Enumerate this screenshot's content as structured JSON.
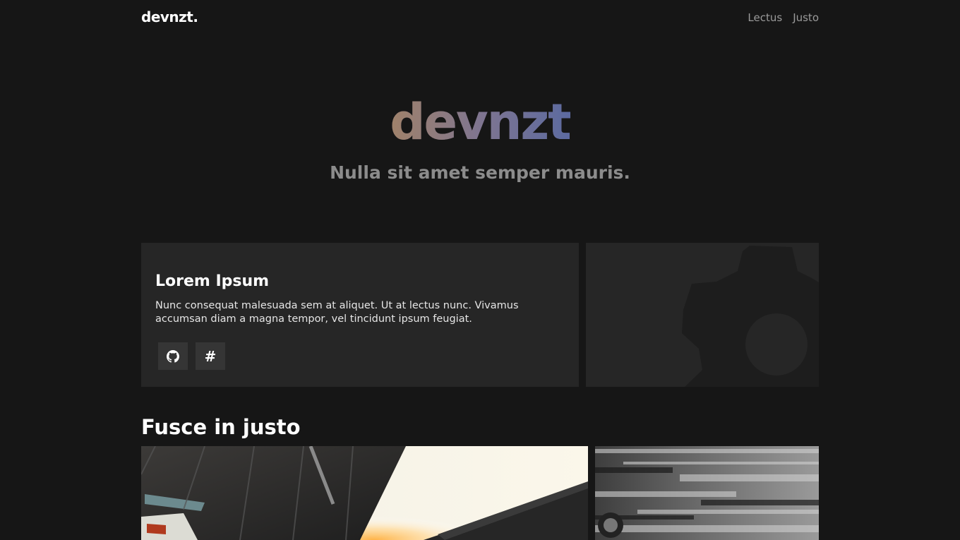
{
  "header": {
    "brand": "devnzt.",
    "nav": [
      {
        "label": "Lectus"
      },
      {
        "label": "Justo"
      }
    ]
  },
  "hero": {
    "title": "devnzt",
    "subtitle": "Nulla sit amet semper mauris."
  },
  "project": {
    "title": "Lorem Ipsum",
    "description": "Nunc consequat malesuada sem at aliquet. Ut at lectus nunc. Vivamus accumsan diam a magna tempor, vel tincidunt ipsum feugiat.",
    "buttons": [
      {
        "icon": "github-icon"
      },
      {
        "icon": "hash-icon",
        "glyph": "#"
      }
    ],
    "image_icon": "gear-icon"
  },
  "section": {
    "title": "Fusce in justo"
  },
  "colors": {
    "background": "#161616",
    "card": "#262626",
    "gradient_start": "#a0826a",
    "gradient_end": "#5c6aa0",
    "muted_text": "#8c8c8c"
  }
}
